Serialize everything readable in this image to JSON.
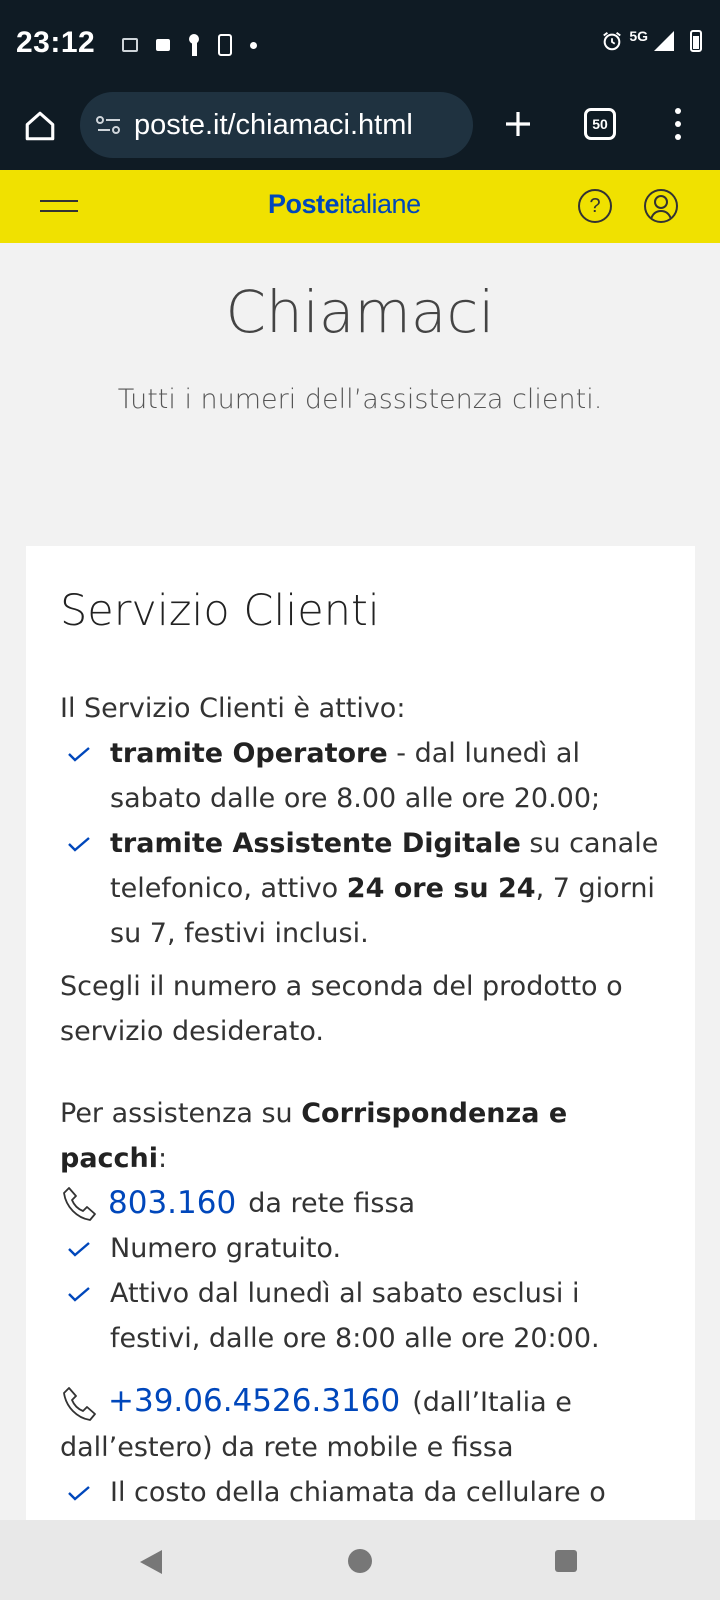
{
  "status_bar": {
    "time": "23:12",
    "network": "5G",
    "icons": [
      "vpn-icon",
      "tag-icon",
      "key-icon",
      "phone-check-icon",
      "dot-icon",
      "alarm-icon",
      "signal-icon",
      "battery-icon"
    ]
  },
  "browser": {
    "url": "poste.it/chiamaci.html",
    "tab_count": "50"
  },
  "site_header": {
    "logo_bold": "Poste",
    "logo_regular": "italiane",
    "help_label": "?",
    "brand_color": "#f0e100",
    "logo_color": "#0047bb"
  },
  "page": {
    "title": "Chiamaci",
    "subtitle": "Tutti i numeri dell’assistenza clienti."
  },
  "card": {
    "title": "Servizio Clienti",
    "intro": "Il Servizio Clienti è attivo:",
    "service_items": [
      {
        "bold": "tramite Operatore",
        "text": " - dal lunedì al sabato dalle ore 8.00 alle ore 20.00;"
      },
      {
        "bold": "tramite Assistente Digitale",
        "text": " su canale telefonico, attivo ",
        "bold2": "24 ore su 24",
        "text2": ", 7 giorni su 7, festivi inclusi."
      }
    ],
    "choose_text": "Scegli il numero a seconda del prodotto o servizio desiderato.",
    "section": {
      "prefix": "Per assistenza su ",
      "bold": "Corrispondenza e pacchi",
      "suffix": ":"
    },
    "phone1": {
      "number": "803.160",
      "note": "da rete fissa",
      "items": [
        "Numero gratuito.",
        "Attivo dal lunedì al sabato esclusi i festivi, dalle ore 8:00 alle ore 20:00."
      ]
    },
    "phone2": {
      "number": "+39.06.4526.3160",
      "note": "(dall’Italia e dall’estero) da rete mobile e fissa",
      "items": [
        "Il costo della chiamata da cellulare o"
      ]
    },
    "link_color": "#0047bb",
    "check_color": "#0047bb"
  }
}
